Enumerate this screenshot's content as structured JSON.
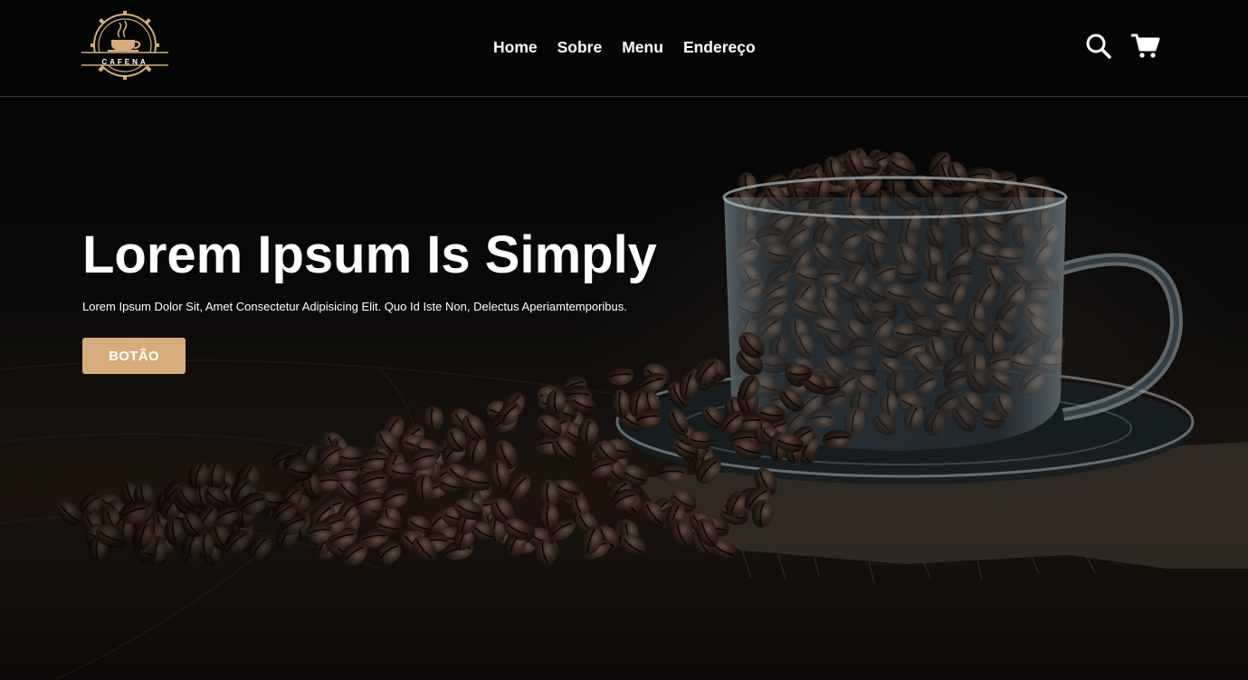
{
  "brand": {
    "logo_text": "CAFENA",
    "logo_icon": "coffee-cup-badge-icon",
    "accent_color": "#d7ac7b"
  },
  "nav": {
    "items": [
      {
        "label": "Home"
      },
      {
        "label": "Sobre"
      },
      {
        "label": "Menu"
      },
      {
        "label": "Endereço"
      }
    ]
  },
  "header_actions": {
    "search_icon": "search-icon",
    "cart_icon": "shopping-cart-icon"
  },
  "hero": {
    "title": "Lorem Ipsum Is Simply",
    "subtitle": "Lorem Ipsum Dolor Sit, Amet Consectetur Adipisicing Elit. Quo Id Iste Non, Delectus Aperiamtemporibus.",
    "button_label": "BOTÃO",
    "image": "coffee-beans-in-glass-cup-photo"
  }
}
